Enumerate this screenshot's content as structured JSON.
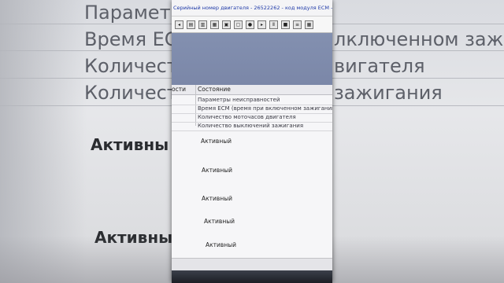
{
  "window": {
    "title": "Серийный номер двигателя - 26522262 - код модуля ECM - 2"
  },
  "toolbar": {
    "icons": [
      "back-icon",
      "copy-icon",
      "paste-icon",
      "print-icon",
      "save-icon",
      "open-icon",
      "record-icon",
      "play-icon",
      "pause-icon",
      "stop-icon",
      "list-icon",
      "grid-icon"
    ]
  },
  "table": {
    "headers": [
      "ости",
      "Состояние"
    ],
    "rows": [
      "Параметры неисправностей",
      "Время ECM (время при включенном зажигании)",
      "Количество моточасов двигателя",
      "Количество выключений зажигания"
    ],
    "active_values": [
      "Активный",
      "Активный",
      "Активный",
      "Активный",
      "Активный"
    ]
  },
  "background": {
    "lines": [
      "Параметр",
      "Время ЕС",
      "Количест",
      "Количест"
    ],
    "lines_right": [
      "",
      "лключенном зажигани",
      "вигателя",
      "зажигания"
    ],
    "bold": [
      "Активны",
      "Активны"
    ],
    "top_partial": "ый номер двигателя · 26522262 · код модуля ECM · 2"
  }
}
